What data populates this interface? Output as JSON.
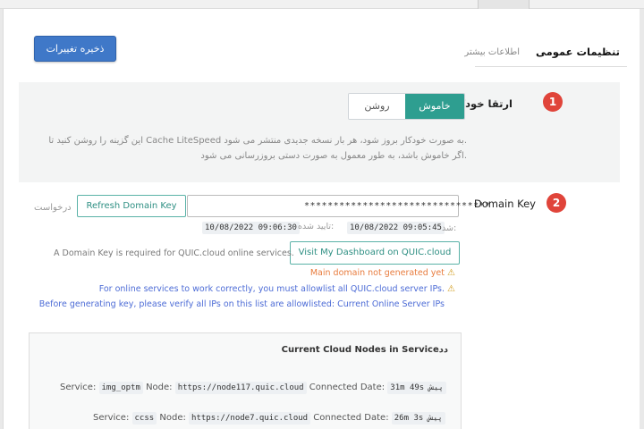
{
  "header": {
    "save_label": "ذخیره تغییرات",
    "title": "تنظیمات عمومی",
    "subtitle": "اطلاعات بیشتر"
  },
  "auto_upgrade": {
    "badge": "1",
    "label": "ارتقا خودکار",
    "toggle_off": "روشن",
    "toggle_on": "خاموش",
    "desc_line1": "این گزینه را روشن کنید تا Cache LiteSpeed به صورت خودکار بروز شود، هر بار نسخه جدیدی منتشر می شود.",
    "desc_line2": "اگر خاموش باشد، به طور معمول به صورت دستی بروزرسانی می شود."
  },
  "domain_key": {
    "badge": "2",
    "label": "Domain Key",
    "key_value": "********************************",
    "refresh_label": "Refresh Domain Key",
    "request_label": "درخواست",
    "timestamp_left": "10/08/2022 09:06:30",
    "verified_label": "تایید شده:",
    "timestamp_right": "10/08/2022 09:05:45",
    "timestamp_suffix": "شد:",
    "dashboard_label": "Visit My Dashboard on QUIC.cloud",
    "required_note": "A Domain Key is required for QUIC.cloud online services.",
    "warn_domain": "Main domain not generated yet",
    "warn_allowlist": "For online services to work correctly, you must allowlist all QUIC.cloud server IPs.",
    "verify_text": "Before generating key, please verify all IPs on this list are allowlisted:",
    "verify_link": "Current Online Server IPs"
  },
  "nodes": {
    "title": "Current Cloud Nodes in Serviceدد",
    "service_label": "Service:",
    "node_label": "Node:",
    "connected_label": "Connected Date:",
    "rows": [
      {
        "service": "img_optm",
        "node": "https://node117.quic.cloud",
        "date": "31m 49s پیش"
      },
      {
        "service": "ccss",
        "node": "https://node7.quic.cloud",
        "date": "26m 3s پیش"
      }
    ]
  },
  "colors": {
    "save_button": "#3f78c8",
    "toggle_active": "#2e9e90",
    "badge": "#e0443a",
    "warning_orange": "#e87c3e",
    "link_blue": "#4d6cd6"
  },
  "icons": {
    "warning": "warning-triangle-icon"
  }
}
